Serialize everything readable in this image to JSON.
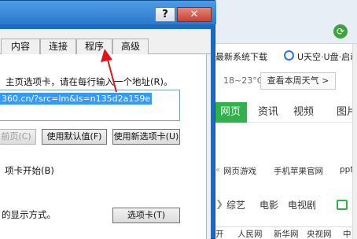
{
  "dialog": {
    "help_label": "?",
    "close_label": "✕",
    "tabs": [
      "内容",
      "连接",
      "程序",
      "高级"
    ],
    "homepage_instruction": "主页选项卡，请在每行输入一个地址(R)。",
    "homepage_url": "360.cn/?src=lm&ls=n135d2a159e",
    "buttons": {
      "use_current": "前页(C)",
      "use_default": "使用默认值(F)",
      "use_new_tab": "使用新选项卡(U)"
    },
    "startup_label": "项卡开始(B)",
    "tabs_display_label": "的显示方式。",
    "tabs_button": "选项卡(T)"
  },
  "browser": {
    "refresh_icon": "refresh-icon",
    "favorites": [
      "最新系统下载",
      "U天空·U盘·启动"
    ],
    "weather": "18~23°C",
    "weather_button": "查看本周天气 >",
    "nav": [
      "网页",
      "资讯",
      "视频",
      "图片"
    ],
    "links": [
      "网页游戏",
      "手机苹果官网",
      "ppt"
    ],
    "categories": [
      "综艺",
      "电影",
      "电视剧"
    ],
    "bottom_links": [
      "开",
      "人民网",
      "新华网",
      "央视网",
      "中"
    ]
  },
  "colors": {
    "titlebar": "#2a79cc",
    "close_button": "#c8412f",
    "selection": "#3399ff",
    "accent_green": "#2fb24a",
    "arrow": "#e01515"
  }
}
